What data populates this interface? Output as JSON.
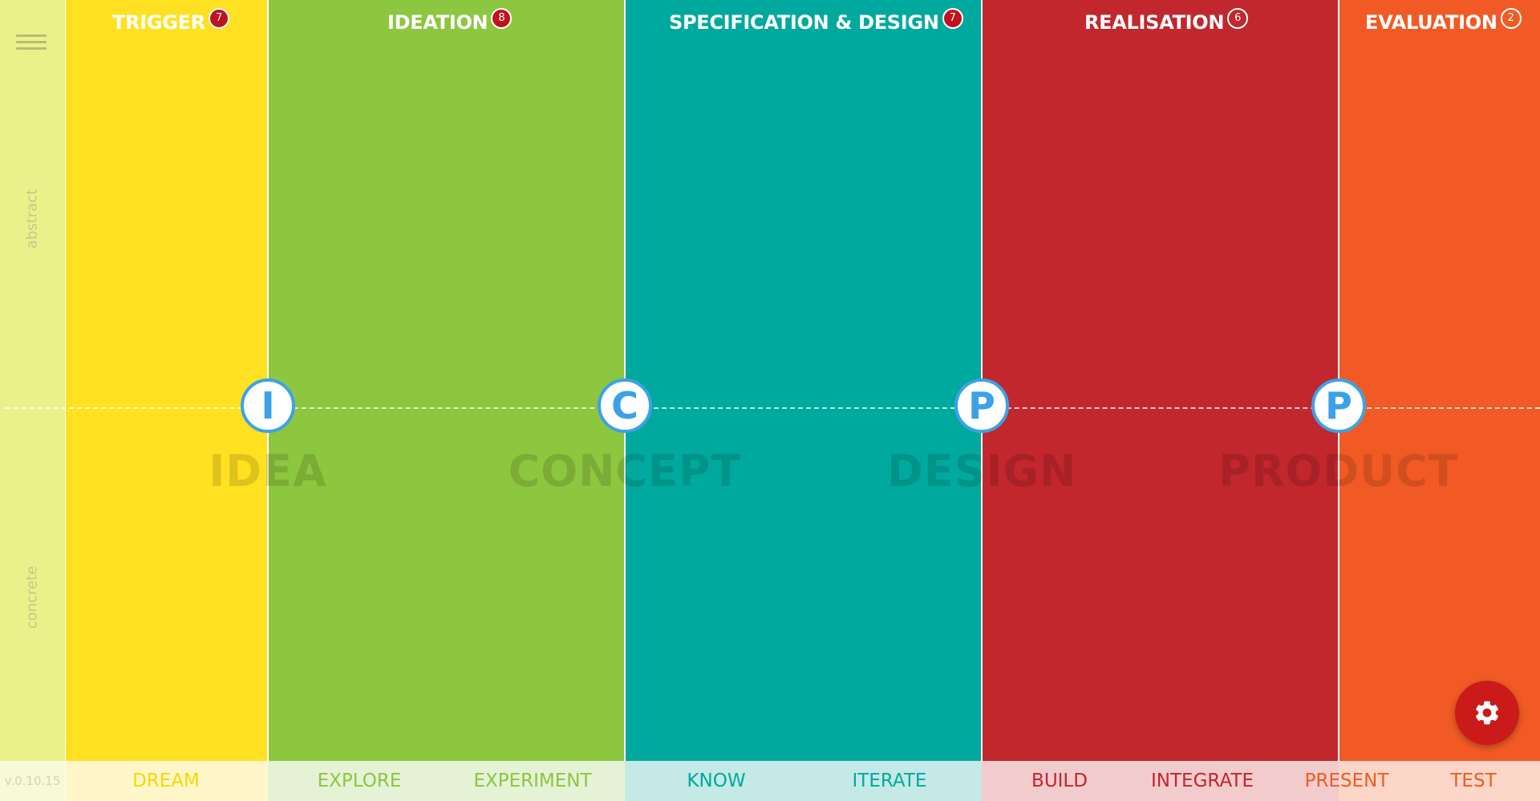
{
  "sidebar": {
    "axis_top": "abstract",
    "axis_bottom": "concrete",
    "version": "v.0.10.15"
  },
  "columns": [
    {
      "title": "TRIGGER",
      "count": "7",
      "color": "#ffe121"
    },
    {
      "title": "IDEATION",
      "count": "8",
      "color": "#8dc63f"
    },
    {
      "title": "SPECIFICATION & DESIGN",
      "count": "7",
      "color": "#00a99d"
    },
    {
      "title": "REALISATION",
      "count": "6",
      "color": "#c1272d"
    },
    {
      "title": "EVALUATION",
      "count": "2",
      "color": "#f15a24"
    }
  ],
  "milestones": [
    {
      "letter": "I",
      "label": "IDEA"
    },
    {
      "letter": "C",
      "label": "CONCEPT"
    },
    {
      "letter": "P",
      "label": "DESIGN"
    },
    {
      "letter": "P",
      "label": "PRODUCT"
    }
  ],
  "phases": [
    {
      "label": "DREAM",
      "color": "#f5d800"
    },
    {
      "label": "EXPLORE",
      "color": "#8dc63f"
    },
    {
      "label": "EXPERIMENT",
      "color": "#8dc63f"
    },
    {
      "label": "KNOW",
      "color": "#00a99d"
    },
    {
      "label": "ITERATE",
      "color": "#00a99d"
    },
    {
      "label": "BUILD",
      "color": "#c1272d"
    },
    {
      "label": "INTEGRATE",
      "color": "#c1272d"
    },
    {
      "label": "PRESENT",
      "color": "#f15a24"
    },
    {
      "label": "TEST",
      "color": "#f15a24"
    }
  ],
  "icons": {
    "menu": "hamburger-menu-icon",
    "settings": "gear-icon"
  }
}
